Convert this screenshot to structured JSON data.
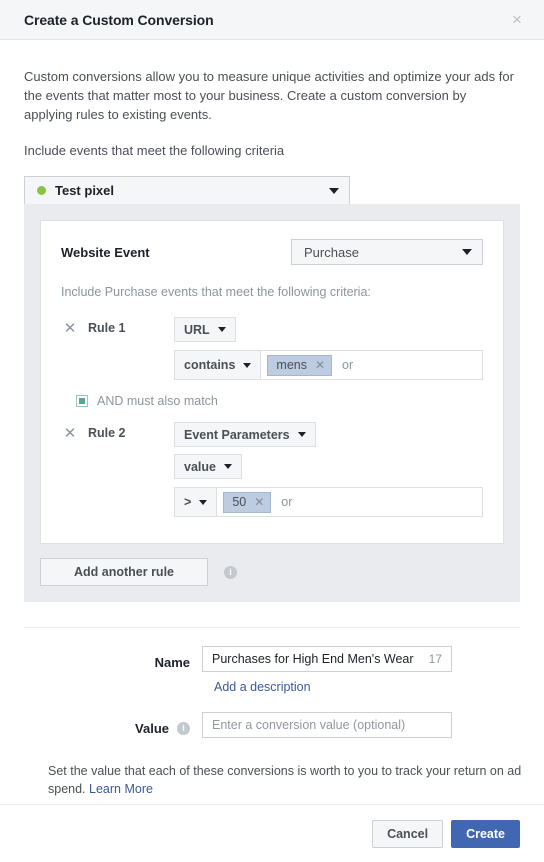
{
  "header": {
    "title": "Create a Custom Conversion",
    "close_label": "×"
  },
  "intro": {
    "paragraph": "Custom conversions allow you to measure unique activities and optimize your ads for the events that matter most to your business. Create a custom conversion by applying rules to existing events.",
    "criteria_line": "Include events that meet the following criteria"
  },
  "pixel_selector": {
    "name": "Test pixel",
    "status_color": "#86c442"
  },
  "rules": {
    "website_event_label": "Website Event",
    "website_event_value": "Purchase",
    "include_line": "Include Purchase events that meet the following criteria:",
    "and_label": "AND must also match",
    "add_rule_label": "Add another rule",
    "info_glyph": "i",
    "remove_glyph": "✕",
    "rule1": {
      "label": "Rule 1",
      "field": "URL",
      "operator": "contains",
      "token": "mens",
      "token_remove_glyph": "✕",
      "or_label": "or"
    },
    "rule2": {
      "label": "Rule 2",
      "field": "Event Parameters",
      "parameter": "value",
      "operator": ">",
      "token": "50",
      "token_remove_glyph": "✕",
      "or_label": "or"
    }
  },
  "form": {
    "name_label": "Name",
    "name_value": "Purchases for High End Men's Wear",
    "name_char_count": "17",
    "add_description_label": "Add a description",
    "value_label": "Value",
    "value_placeholder": "Enter a conversion value (optional)",
    "value_info_glyph": "i",
    "footnote": "Set the value that each of these conversions is worth to you to track your return on ad spend. ",
    "learn_more_label": "Learn More"
  },
  "footer": {
    "cancel_label": "Cancel",
    "create_label": "Create",
    "primary_color": "#4267b2"
  }
}
